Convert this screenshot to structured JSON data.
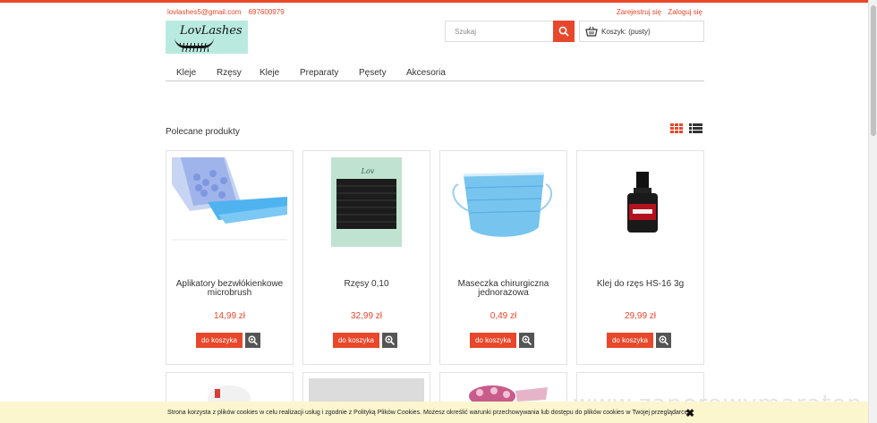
{
  "header": {
    "email": "lovlashes5@gmail.com",
    "phone": "697600979",
    "register": "Zarejestruj się",
    "login": "Zaloguj się",
    "logo_text": "LovLashes"
  },
  "search": {
    "placeholder": "Szukaj"
  },
  "cart": {
    "label": "Koszyk: (pusty)"
  },
  "nav": [
    "Kleje",
    "Rzęsy",
    "Kleje",
    "Preparaty",
    "Pęsety",
    "Akcesoria"
  ],
  "section_title": "Polecane produkty",
  "products": [
    {
      "name": "Aplikatory bezwłókienkowe microbrush",
      "price": "14,99 zł",
      "button": "do koszyka"
    },
    {
      "name": "Rzęsy 0,10",
      "price": "32,99 zł",
      "button": "do koszyka"
    },
    {
      "name": "Maseczka chirurgiczna jednorazowa",
      "price": "0,49 zł",
      "button": "do koszyka"
    },
    {
      "name": "Klej do rzęs HS-16 3g",
      "price": "29,99 zł",
      "button": "do koszyka"
    }
  ],
  "cookie": {
    "text": "Strona korzysta z plików cookies w celu realizacji usług i zgodnie z Polityką Plików Cookies. Możesz określić warunki przechowywania lub dostępu do plików cookies w Twojej przeglądarce."
  },
  "watermark": "www.zaporowymaraton.pl",
  "colors": {
    "accent": "#e8472b",
    "cookie_bg": "#fbf6ce",
    "logo_bg": "#b9eae0"
  }
}
